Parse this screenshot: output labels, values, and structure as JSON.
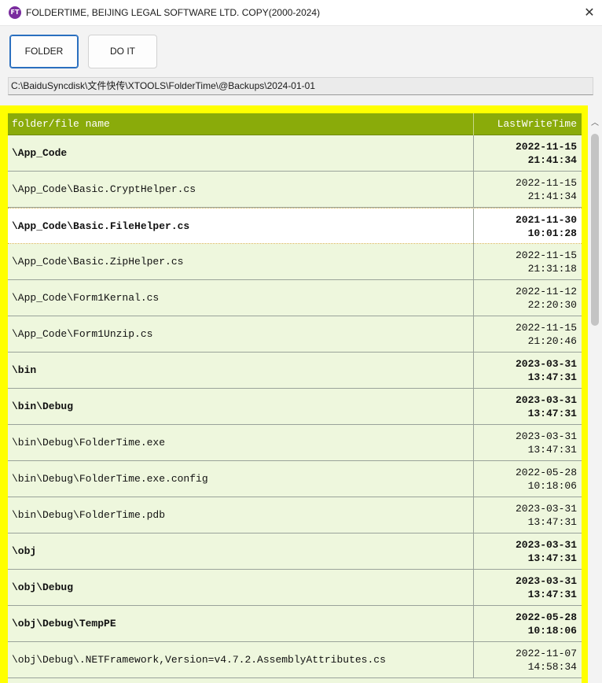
{
  "window": {
    "icon_text": "FT",
    "title": "FOLDERTIME, BEIJING LEGAL SOFTWARE LTD. COPY(2000-2024)",
    "close_glyph": "✕",
    "icons": {
      "app": "app-logo-icon",
      "close": "close-icon"
    }
  },
  "toolbar": {
    "folder_label": "FOLDER",
    "doit_label": "DO IT"
  },
  "path": {
    "value": "C:\\BaiduSyncdisk\\文件快传\\XTOOLS\\FolderTime\\@Backups\\2024-01-01"
  },
  "grid": {
    "columns": {
      "name": "folder/file name",
      "time": "LastWriteTime"
    },
    "colors": {
      "frame": "#ffff00",
      "header": "#8aab0a",
      "row": "#eef7dd",
      "selected": "#ffffff"
    },
    "rows": [
      {
        "name": "\\App_Code",
        "date": "2022-11-15",
        "time": "21:41:34",
        "bold": true,
        "selected": false
      },
      {
        "name": "\\App_Code\\Basic.CryptHelper.cs",
        "date": "2022-11-15",
        "time": "21:41:34",
        "bold": false,
        "selected": false
      },
      {
        "name": "\\App_Code\\Basic.FileHelper.cs",
        "date": "2021-11-30",
        "time": "10:01:28",
        "bold": true,
        "selected": true
      },
      {
        "name": "\\App_Code\\Basic.ZipHelper.cs",
        "date": "2022-11-15",
        "time": "21:31:18",
        "bold": false,
        "selected": false
      },
      {
        "name": "\\App_Code\\Form1Kernal.cs",
        "date": "2022-11-12",
        "time": "22:20:30",
        "bold": false,
        "selected": false
      },
      {
        "name": "\\App_Code\\Form1Unzip.cs",
        "date": "2022-11-15",
        "time": "21:20:46",
        "bold": false,
        "selected": false
      },
      {
        "name": "\\bin",
        "date": "2023-03-31",
        "time": "13:47:31",
        "bold": true,
        "selected": false
      },
      {
        "name": "\\bin\\Debug",
        "date": "2023-03-31",
        "time": "13:47:31",
        "bold": true,
        "selected": false
      },
      {
        "name": "\\bin\\Debug\\FolderTime.exe",
        "date": "2023-03-31",
        "time": "13:47:31",
        "bold": false,
        "selected": false
      },
      {
        "name": "\\bin\\Debug\\FolderTime.exe.config",
        "date": "2022-05-28",
        "time": "10:18:06",
        "bold": false,
        "selected": false
      },
      {
        "name": "\\bin\\Debug\\FolderTime.pdb",
        "date": "2023-03-31",
        "time": "13:47:31",
        "bold": false,
        "selected": false
      },
      {
        "name": "\\obj",
        "date": "2023-03-31",
        "time": "13:47:31",
        "bold": true,
        "selected": false
      },
      {
        "name": "\\obj\\Debug",
        "date": "2023-03-31",
        "time": "13:47:31",
        "bold": true,
        "selected": false
      },
      {
        "name": "\\obj\\Debug\\TempPE",
        "date": "2022-05-28",
        "time": "10:18:06",
        "bold": true,
        "selected": false
      },
      {
        "name": "\\obj\\Debug\\.NETFramework,Version=v4.7.2.AssemblyAttributes.cs",
        "date": "2022-11-07",
        "time": "14:58:34",
        "bold": false,
        "selected": false
      }
    ]
  },
  "scrollbar": {
    "up_glyph": "︿",
    "icon": "chevron-up-icon"
  }
}
